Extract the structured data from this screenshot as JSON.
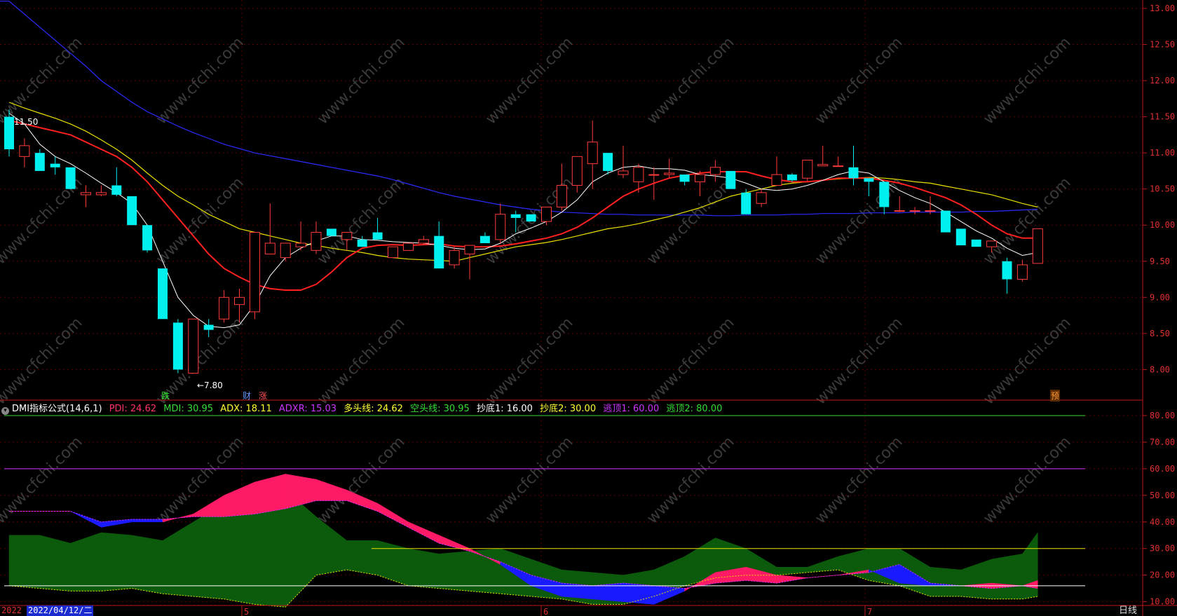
{
  "price_axis": {
    "ticks": [
      "13.00",
      "12.50",
      "12.00",
      "11.50",
      "11.00",
      "10.50",
      "10.00",
      "9.50",
      "9.00",
      "8.50",
      "8.00"
    ]
  },
  "indicator_axis": {
    "ticks": [
      "80.00",
      "70.00",
      "60.00",
      "50.00",
      "40.00",
      "30.00",
      "20.00",
      "10.00"
    ]
  },
  "annotations": {
    "high_label": "11.50",
    "low_label": "←7.80"
  },
  "event_markers": [
    {
      "text": "跌",
      "color": "#33ee33"
    },
    {
      "text": "财",
      "color": "#6699ff"
    },
    {
      "text": "涨",
      "color": "#ff5555"
    },
    {
      "text": "预",
      "color": "#ff9933"
    }
  ],
  "indicator": {
    "name": "DMI指标公式(14,6,1)",
    "items": [
      {
        "label": "PDI: 24.62",
        "color": "#ff3366"
      },
      {
        "label": "MDI: 30.95",
        "color": "#33dd33"
      },
      {
        "label": "ADX: 18.11",
        "color": "#ffff33"
      },
      {
        "label": "ADXR: 15.03",
        "color": "#cc33ff"
      },
      {
        "label": "多头线: 24.62",
        "color": "#ffff33"
      },
      {
        "label": "空头线: 30.95",
        "color": "#33dd33"
      },
      {
        "label": "抄底1: 16.00",
        "color": "#ffffff"
      },
      {
        "label": "抄底2: 30.00",
        "color": "#ffff33"
      },
      {
        "label": "逃顶1: 60.00",
        "color": "#cc33ff"
      },
      {
        "label": "逃顶2: 80.00",
        "color": "#33dd33"
      }
    ]
  },
  "date_bar": {
    "selected_date": "2022/04/12/二",
    "year_stub": "2022",
    "month_labels": [
      "5",
      "6",
      "7"
    ],
    "period": "日线"
  },
  "watermark": "www.cfchi.com",
  "colors": {
    "up": "#ff3b3b",
    "down": "#00f0f0",
    "ma5": "#ffffff",
    "ma10": "#ff2020",
    "ma20": "#e8e000",
    "ma60": "#2b2bff",
    "grid": "#5a0000",
    "axis": "#c01818"
  },
  "chart_data": [
    {
      "type": "candlestick",
      "title": "",
      "ylim": [
        7.75,
        13.1
      ],
      "ohlc": [
        [
          11.5,
          11.6,
          10.95,
          11.05
        ],
        [
          10.95,
          11.2,
          10.8,
          11.1
        ],
        [
          11.0,
          11.05,
          10.75,
          10.75
        ],
        [
          10.85,
          10.95,
          10.7,
          10.8
        ],
        [
          10.8,
          10.8,
          10.5,
          10.5
        ],
        [
          10.42,
          10.55,
          10.25,
          10.45
        ],
        [
          10.42,
          10.55,
          10.4,
          10.45
        ],
        [
          10.55,
          10.8,
          10.4,
          10.42
        ],
        [
          10.4,
          10.4,
          10.0,
          10.0
        ],
        [
          10.0,
          10.0,
          9.62,
          9.65
        ],
        [
          9.4,
          9.4,
          8.7,
          8.7
        ],
        [
          8.65,
          8.7,
          7.95,
          8.0
        ],
        [
          7.95,
          8.7,
          7.95,
          8.7
        ],
        [
          8.62,
          8.7,
          8.45,
          8.55
        ],
        [
          8.7,
          9.1,
          8.65,
          9.0
        ],
        [
          8.9,
          9.12,
          8.65,
          9.0
        ],
        [
          8.8,
          9.9,
          8.7,
          9.9
        ],
        [
          9.6,
          10.3,
          9.6,
          9.75
        ],
        [
          9.55,
          9.75,
          9.5,
          9.75
        ],
        [
          9.7,
          10.05,
          9.65,
          9.75
        ],
        [
          9.65,
          10.05,
          9.6,
          9.9
        ],
        [
          9.95,
          9.95,
          9.85,
          9.85
        ],
        [
          9.8,
          9.85,
          9.65,
          9.9
        ],
        [
          9.8,
          9.85,
          9.7,
          9.7
        ],
        [
          9.9,
          10.1,
          9.8,
          9.8
        ],
        [
          9.55,
          9.7,
          9.55,
          9.7
        ],
        [
          9.65,
          9.75,
          9.65,
          9.75
        ],
        [
          9.75,
          9.85,
          9.72,
          9.8
        ],
        [
          9.85,
          10.05,
          9.4,
          9.4
        ],
        [
          9.45,
          9.7,
          9.4,
          9.65
        ],
        [
          9.6,
          9.72,
          9.25,
          9.72
        ],
        [
          9.85,
          9.9,
          9.75,
          9.75
        ],
        [
          9.8,
          10.3,
          9.75,
          10.15
        ],
        [
          10.15,
          10.2,
          9.9,
          10.1
        ],
        [
          10.15,
          10.15,
          10.05,
          10.05
        ],
        [
          10.05,
          10.25,
          10.0,
          10.25
        ],
        [
          10.25,
          10.85,
          10.2,
          10.55
        ],
        [
          10.55,
          10.95,
          10.45,
          10.95
        ],
        [
          10.85,
          11.45,
          10.5,
          11.15
        ],
        [
          11.0,
          11.0,
          10.7,
          10.75
        ],
        [
          10.7,
          11.1,
          10.65,
          10.75
        ],
        [
          10.6,
          10.85,
          10.45,
          10.8
        ],
        [
          10.7,
          10.8,
          10.35,
          10.7
        ],
        [
          10.7,
          10.92,
          10.65,
          10.72
        ],
        [
          10.7,
          10.7,
          10.55,
          10.6
        ],
        [
          10.6,
          10.75,
          10.4,
          10.7
        ],
        [
          10.7,
          10.9,
          10.6,
          10.8
        ],
        [
          10.75,
          10.75,
          10.5,
          10.5
        ],
        [
          10.45,
          10.5,
          10.15,
          10.15
        ],
        [
          10.3,
          10.5,
          10.25,
          10.45
        ],
        [
          10.55,
          10.95,
          10.55,
          10.7
        ],
        [
          10.7,
          10.72,
          10.6,
          10.62
        ],
        [
          10.65,
          10.9,
          10.6,
          10.9
        ],
        [
          10.82,
          11.1,
          10.82,
          10.84
        ],
        [
          10.82,
          10.95,
          10.82,
          10.82
        ],
        [
          10.8,
          11.1,
          10.55,
          10.65
        ],
        [
          10.65,
          10.65,
          10.4,
          10.6
        ],
        [
          10.6,
          10.6,
          10.15,
          10.25
        ],
        [
          10.2,
          10.4,
          10.18,
          10.2
        ],
        [
          10.2,
          10.25,
          10.15,
          10.2
        ],
        [
          10.2,
          10.4,
          10.15,
          10.2
        ],
        [
          10.2,
          10.2,
          9.9,
          9.9
        ],
        [
          9.95,
          9.95,
          9.72,
          9.72
        ],
        [
          9.8,
          9.8,
          9.7,
          9.7
        ],
        [
          9.7,
          9.75,
          9.62,
          9.78
        ],
        [
          9.5,
          9.55,
          9.05,
          9.25
        ],
        [
          9.25,
          9.52,
          9.22,
          9.45
        ],
        [
          9.47,
          9.95,
          9.47,
          9.95
        ]
      ],
      "ma5": [
        11.55,
        11.4,
        11.12,
        10.95,
        10.85,
        10.72,
        10.58,
        10.45,
        10.3,
        10.0,
        9.5,
        9.0,
        8.75,
        8.6,
        8.58,
        8.62,
        8.9,
        9.3,
        9.55,
        9.68,
        9.78,
        9.85,
        9.85,
        9.8,
        9.79,
        9.77,
        9.76,
        9.75,
        9.72,
        9.68,
        9.66,
        9.67,
        9.75,
        9.88,
        9.96,
        10.05,
        10.18,
        10.35,
        10.6,
        10.72,
        10.8,
        10.82,
        10.78,
        10.78,
        10.76,
        10.7,
        10.68,
        10.65,
        10.58,
        10.5,
        10.48,
        10.5,
        10.55,
        10.62,
        10.7,
        10.75,
        10.72,
        10.6,
        10.48,
        10.38,
        10.3,
        10.18,
        10.05,
        9.92,
        9.82,
        9.68,
        9.58,
        9.62
      ],
      "ma10": [
        11.45,
        11.4,
        11.35,
        11.3,
        11.25,
        11.15,
        11.05,
        10.95,
        10.8,
        10.6,
        10.35,
        10.1,
        9.85,
        9.6,
        9.4,
        9.28,
        9.18,
        9.12,
        9.1,
        9.1,
        9.18,
        9.35,
        9.55,
        9.68,
        9.72,
        9.73,
        9.72,
        9.73,
        9.74,
        9.71,
        9.7,
        9.7,
        9.71,
        9.74,
        9.78,
        9.82,
        9.88,
        9.97,
        10.1,
        10.25,
        10.4,
        10.5,
        10.58,
        10.65,
        10.69,
        10.72,
        10.74,
        10.74,
        10.74,
        10.68,
        10.63,
        10.6,
        10.6,
        10.62,
        10.65,
        10.65,
        10.65,
        10.62,
        10.58,
        10.52,
        10.45,
        10.38,
        10.28,
        10.15,
        10.0,
        9.88,
        9.82,
        9.82
      ],
      "ma20": [
        11.7,
        11.62,
        11.55,
        11.48,
        11.4,
        11.3,
        11.18,
        11.05,
        10.9,
        10.72,
        10.55,
        10.4,
        10.28,
        10.15,
        10.05,
        9.95,
        9.9,
        9.85,
        9.8,
        9.75,
        9.72,
        9.68,
        9.65,
        9.62,
        9.58,
        9.55,
        9.53,
        9.52,
        9.51,
        9.5,
        9.55,
        9.6,
        9.65,
        9.7,
        9.73,
        9.76,
        9.8,
        9.85,
        9.9,
        9.95,
        9.98,
        10.02,
        10.07,
        10.12,
        10.18,
        10.24,
        10.32,
        10.4,
        10.45,
        10.5,
        10.55,
        10.58,
        10.6,
        10.62,
        10.64,
        10.65,
        10.66,
        10.65,
        10.63,
        10.6,
        10.58,
        10.54,
        10.5,
        10.46,
        10.42,
        10.36,
        10.3,
        10.25
      ],
      "ma60": [
        13.1,
        12.92,
        12.74,
        12.56,
        12.38,
        12.2,
        12.0,
        11.85,
        11.7,
        11.57,
        11.47,
        11.37,
        11.28,
        11.2,
        11.12,
        11.06,
        11.0,
        10.96,
        10.92,
        10.88,
        10.84,
        10.8,
        10.76,
        10.72,
        10.68,
        10.63,
        10.57,
        10.51,
        10.45,
        10.4,
        10.36,
        10.32,
        10.28,
        10.25,
        10.22,
        10.2,
        10.18,
        10.17,
        10.16,
        10.15,
        10.15,
        10.14,
        10.14,
        10.14,
        10.14,
        10.14,
        10.13,
        10.13,
        10.14,
        10.14,
        10.14,
        10.15,
        10.15,
        10.16,
        10.16,
        10.16,
        10.17,
        10.17,
        10.17,
        10.18,
        10.18,
        10.18,
        10.18,
        10.19,
        10.19,
        10.2,
        10.21,
        10.22
      ]
    },
    {
      "type": "area",
      "title": "",
      "ylim": [
        5,
        85
      ],
      "x": [
        0,
        2,
        4,
        6,
        8,
        10,
        12,
        14,
        16,
        18,
        20,
        22,
        24,
        26,
        28,
        30,
        32,
        34,
        36,
        38,
        40,
        42,
        44,
        46,
        48,
        50,
        52,
        54,
        56,
        58,
        60,
        62,
        64,
        66,
        67
      ],
      "series": [
        {
          "name": "PDI",
          "values": [
            44,
            44,
            44,
            38,
            40,
            40,
            43,
            50,
            55,
            58,
            56,
            52,
            47,
            40,
            35,
            30,
            24,
            16,
            12,
            11,
            10,
            9,
            14,
            21,
            23,
            20,
            19,
            20,
            22,
            17,
            16,
            16,
            17,
            16,
            18
          ]
        },
        {
          "name": "MDI",
          "values": [
            35,
            35,
            32,
            36,
            35,
            33,
            40,
            47,
            55,
            52,
            42,
            33,
            33,
            30,
            28,
            29,
            30,
            26,
            22,
            21,
            20,
            22,
            27,
            34,
            30,
            23,
            23,
            27,
            30,
            30,
            23,
            22,
            26,
            28,
            36
          ]
        },
        {
          "name": "ADX",
          "values": [
            16,
            15,
            14,
            14,
            15,
            13,
            12,
            11,
            9,
            8,
            20,
            22,
            20,
            16,
            15,
            14,
            13,
            12,
            11,
            9,
            9,
            12,
            16,
            19,
            20,
            20,
            21,
            22,
            18,
            16,
            12,
            12,
            11,
            11,
            12
          ]
        },
        {
          "name": "ADXR",
          "values": [
            44,
            44,
            44,
            40,
            41,
            41,
            42,
            42,
            43,
            45,
            48,
            48,
            44,
            38,
            32,
            29,
            25,
            20,
            17,
            16,
            17,
            16,
            15,
            17,
            18,
            17,
            19,
            20,
            21,
            24,
            17,
            16,
            15,
            16,
            15
          ]
        }
      ],
      "reference_lines": [
        {
          "name": "抄底1",
          "value": 16
        },
        {
          "name": "抄底2",
          "value": 30
        },
        {
          "name": "逃顶1",
          "value": 60
        },
        {
          "name": "逃顶2",
          "value": 80
        }
      ]
    }
  ]
}
